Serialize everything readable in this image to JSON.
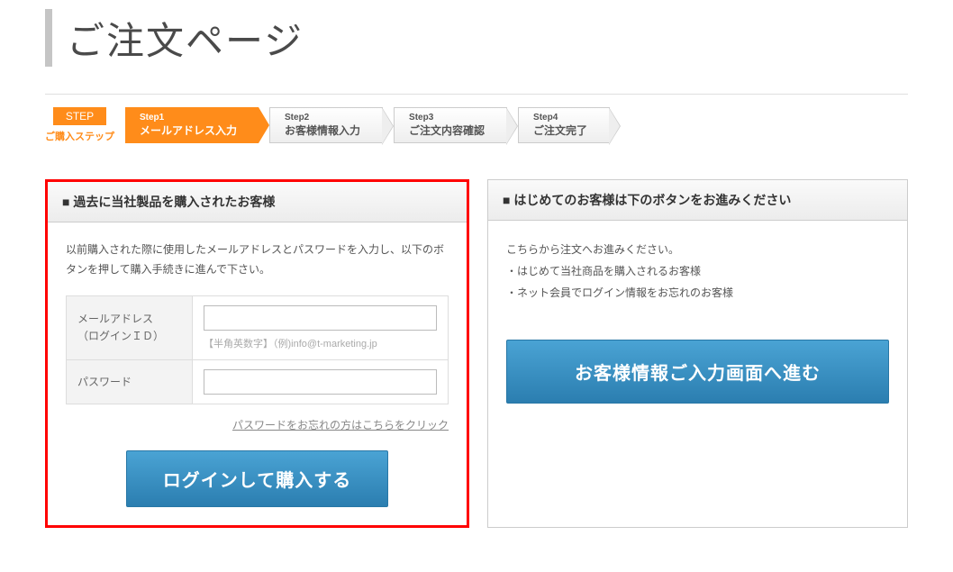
{
  "page": {
    "title": "ご注文ページ"
  },
  "steps": {
    "label_top": "STEP",
    "label_bottom": "ご購入ステップ",
    "items": [
      {
        "num": "Step1",
        "txt": "メールアドレス入力"
      },
      {
        "num": "Step2",
        "txt": "お客様情報入力"
      },
      {
        "num": "Step3",
        "txt": "ご注文内容確認"
      },
      {
        "num": "Step4",
        "txt": "ご注文完了"
      }
    ]
  },
  "left": {
    "header": "■ 過去に当社製品を購入されたお客様",
    "desc": "以前購入された際に使用したメールアドレスとパスワードを入力し、以下のボタンを押して購入手続きに進んで下さい。",
    "email_label_l1": "メールアドレス",
    "email_label_l2": "（ログインＩＤ）",
    "email_hint": "【半角英数字】（例)info@t-marketing.jp",
    "password_label": "パスワード",
    "forgot": "パスワードをお忘れの方はこちらをクリック",
    "button": "ログインして購入する"
  },
  "right": {
    "header": "■ はじめてのお客様は下のボタンをお進みください",
    "lead": "こちらから注文へお進みください。",
    "bullet1": "・はじめて当社商品を購入されるお客様",
    "bullet2": "・ネット会員でログイン情報をお忘れのお客様",
    "button": "お客様情報ご入力画面へ進む"
  }
}
